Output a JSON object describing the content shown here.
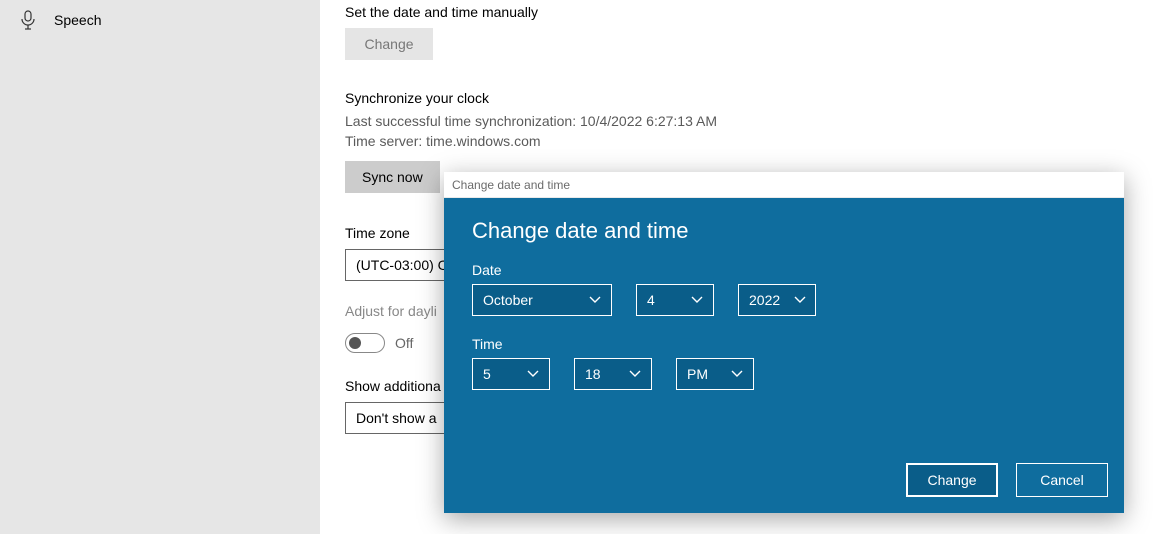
{
  "sidebar": {
    "speech": {
      "label": "Speech"
    }
  },
  "main": {
    "manual": {
      "heading": "Set the date and time manually",
      "change_label": "Change"
    },
    "sync": {
      "heading": "Synchronize your clock",
      "last_sync": "Last successful time synchronization: 10/4/2022 6:27:13 AM",
      "server": "Time server: time.windows.com",
      "sync_label": "Sync now"
    },
    "timezone": {
      "heading": "Time zone",
      "value": "(UTC-03:00) C"
    },
    "adjust": {
      "heading": "Adjust for dayli",
      "state": "Off"
    },
    "additional": {
      "heading": "Show additiona",
      "value": "Don't show a"
    }
  },
  "dialog": {
    "titlebar": "Change date and time",
    "heading": "Change date and time",
    "date_label": "Date",
    "time_label": "Time",
    "month": "October",
    "day": "4",
    "year": "2022",
    "hour": "5",
    "minute": "18",
    "ampm": "PM",
    "change_label": "Change",
    "cancel_label": "Cancel"
  }
}
